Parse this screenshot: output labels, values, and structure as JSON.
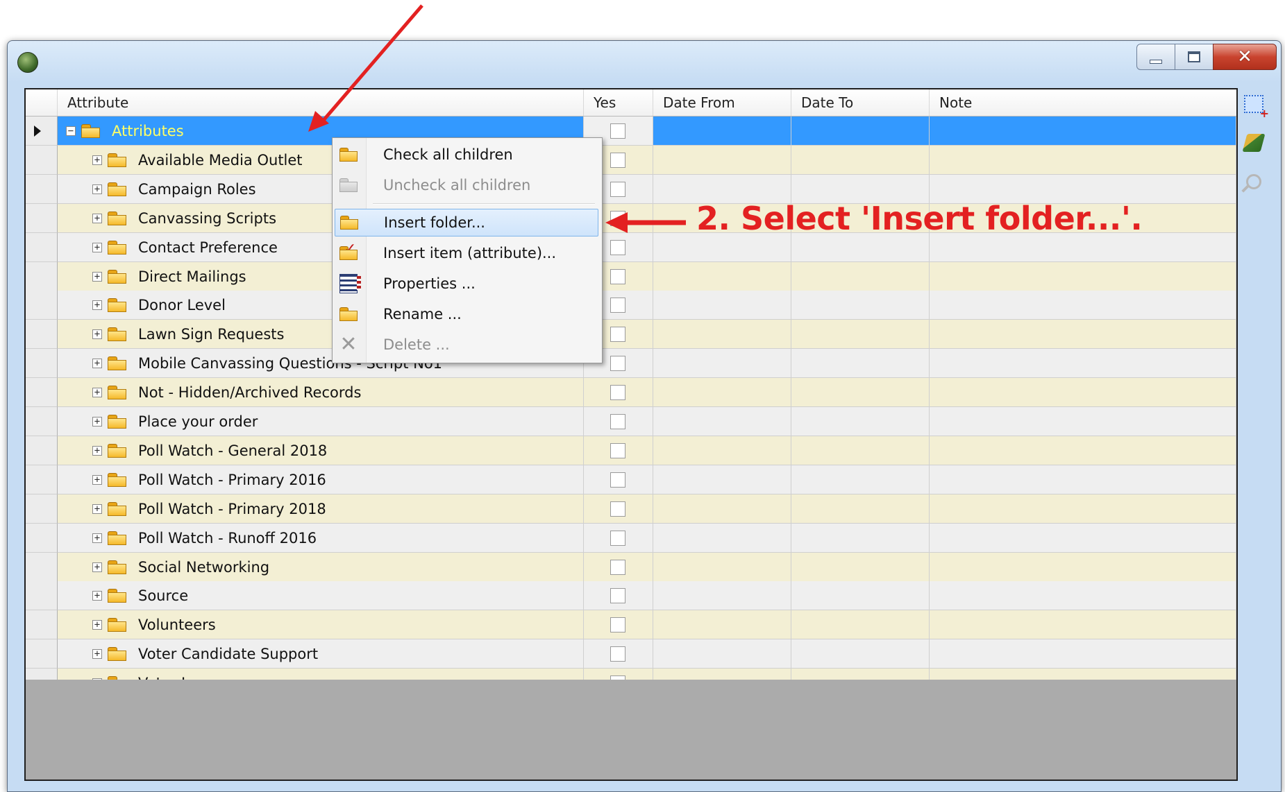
{
  "window": {
    "caption_buttons": [
      "minimize",
      "maximize",
      "close"
    ],
    "colors": {
      "title_gradient_top": "#dcebfa",
      "selection": "#3399ff",
      "row_beige": "#f3efd4",
      "row_gray": "#efefef",
      "annotation": "#e32121"
    }
  },
  "grid": {
    "columns": {
      "attribute": "Attribute",
      "yes": "Yes",
      "date_from": "Date From",
      "date_to": "Date To",
      "note": "Note"
    },
    "root": {
      "label": "Attributes",
      "expanded": true,
      "selected": true
    },
    "items": [
      {
        "label": "Available Media Outlet"
      },
      {
        "label": "Campaign Roles"
      },
      {
        "label": "Canvassing Scripts"
      },
      {
        "label": "Contact Preference"
      },
      {
        "label": "Direct Mailings"
      },
      {
        "label": "Donor Level"
      },
      {
        "label": "Lawn Sign Requests"
      },
      {
        "label": "Mobile Canvassing Questions - Script No1"
      },
      {
        "label": "Not - Hidden/Archived Records"
      },
      {
        "label": "Place your order"
      },
      {
        "label": "Poll Watch - General 2018"
      },
      {
        "label": "Poll Watch - Primary 2016"
      },
      {
        "label": "Poll Watch - Primary 2018"
      },
      {
        "label": "Poll Watch - Runoff 2016"
      },
      {
        "label": "Social Networking"
      },
      {
        "label": "Source"
      },
      {
        "label": "Volunteers"
      },
      {
        "label": "Voter Candidate Support"
      },
      {
        "label": "Voter Issues"
      }
    ]
  },
  "toolbar": {
    "icons": [
      "insert-row-icon",
      "clear-broom-icon",
      "search-icon"
    ]
  },
  "context_menu": {
    "items": [
      {
        "label": "Check all children",
        "icon": "folder-icon",
        "enabled": true
      },
      {
        "label": "Uncheck all children",
        "icon": "folder-gray-icon",
        "enabled": false
      },
      {
        "label": "Insert folder...",
        "icon": "folder-icon",
        "enabled": true,
        "highlighted": true
      },
      {
        "label": "Insert item (attribute)...",
        "icon": "insert-item-icon",
        "enabled": true
      },
      {
        "label": "Properties ...",
        "icon": "properties-icon",
        "enabled": true
      },
      {
        "label": "Rename ...",
        "icon": "folder-icon",
        "enabled": true
      },
      {
        "label": "Delete ...",
        "icon": "delete-icon",
        "enabled": false
      }
    ]
  },
  "annotation": {
    "step_text": "2. Select 'Insert folder...'."
  }
}
